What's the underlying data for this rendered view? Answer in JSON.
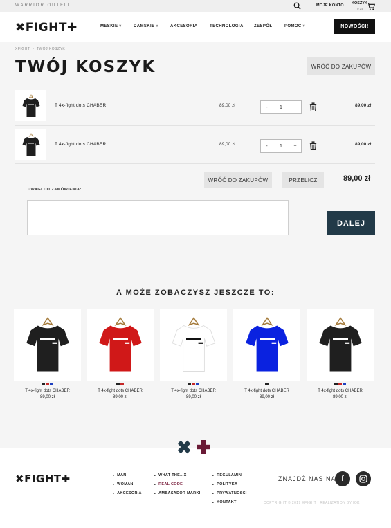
{
  "topbar": {
    "tagline": "WARRIOR OUTFIT",
    "account_label": "MOJE KONTO",
    "cart_label": "KOSZYK",
    "cart_amount": "0 ZŁ"
  },
  "header": {
    "logo": "✖FIGHT✚",
    "nav": [
      {
        "label": "MESKIE",
        "dropdown": true
      },
      {
        "label": "DAMSKIE",
        "dropdown": true
      },
      {
        "label": "AKCESORIA",
        "dropdown": false
      },
      {
        "label": "TECHNOLOGIA",
        "dropdown": false
      },
      {
        "label": "ZESPÓŁ",
        "dropdown": false
      },
      {
        "label": "POMOC",
        "dropdown": true
      }
    ],
    "news_button": "NOWOŚCI!"
  },
  "breadcrumb": {
    "home": "XFIGHT",
    "separator": "›",
    "current": "TWÓJ KOSZYK"
  },
  "page_title": "TWÓJ KOSZYK",
  "back_button_label": "WRÓĆ DO ZAKUPÓW",
  "cart": {
    "items": [
      {
        "name": "T 4x-fight dots CHABER",
        "price": "89,00 zł",
        "qty": "1",
        "total": "89,00 zł"
      },
      {
        "name": "T 4x-fight dots CHABER",
        "price": "89,00 zł",
        "qty": "1",
        "total": "89,00 zł"
      }
    ],
    "minus": "-",
    "plus": "+",
    "back_button": "WRÓĆ DO ZAKUPÓW",
    "recalc_button": "PRZELICZ",
    "sum": "89,00 zł",
    "notes_label": "UWAGI DO ZAMÓWIENIA:",
    "next_button": "DALEJ"
  },
  "recommendations": {
    "title": "A MOŻE ZOBACZYSZ JESZCZE TO:",
    "products": [
      {
        "name": "T 4x-fight dots CHABER",
        "price": "89,00 zł",
        "color": "#1f1f1f",
        "swatches": [
          "#222222",
          "#c62828",
          "#1e3fbf"
        ]
      },
      {
        "name": "T 4x-fight dots CHABER",
        "price": "89,00 zł",
        "color": "#d01818",
        "swatches": [
          "#222222",
          "#c62828"
        ]
      },
      {
        "name": "T 4x-fight dots CHABER",
        "price": "89,00 zł",
        "color": "#ffffff",
        "swatches": [
          "#222222",
          "#c62828",
          "#1e3fbf"
        ]
      },
      {
        "name": "T 4x-fight dots CHABER",
        "price": "89,00 zł",
        "color": "#0a22e0",
        "swatches": [
          "#222222"
        ]
      },
      {
        "name": "T 4x-fight dots CHABER",
        "price": "89,00 zł",
        "color": "#1f1f1f",
        "swatches": [
          "#222222",
          "#c62828",
          "#1e3fbf"
        ]
      }
    ]
  },
  "footer": {
    "logo": "✖FIGHT✚",
    "col1": [
      "MAN",
      "WOMAN",
      "AKCESORIA"
    ],
    "col2": [
      "WHAT THE.. X",
      "REAL CODE",
      "AMBASADOR MARKI"
    ],
    "col3": [
      "REGULAMIN",
      "POLITYKA",
      "PRYWATNOŚCI",
      "KONTAKT"
    ],
    "find_us": "ZNAJDŹ NAS NA:",
    "facebook_glyph": "f",
    "copyright": "COPYRIGHT © 2019 XFIGHT  |  REALIZATION BY IOK"
  },
  "colors": {
    "accent_dark": "#223a48",
    "accent_wine": "#7a1f3d",
    "black": "#111111"
  }
}
